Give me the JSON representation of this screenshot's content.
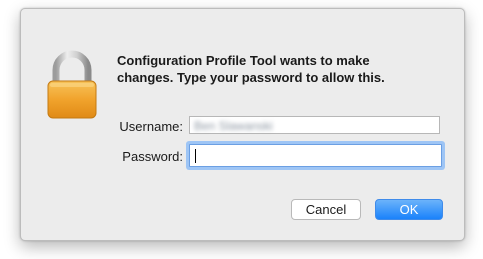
{
  "dialog": {
    "message_lines": [
      "Configuration Profile Tool wants to make",
      "changes. Type your password to allow this."
    ],
    "icon": "lock-icon",
    "username_label": "Username:",
    "username_value": "Ben Slawanski",
    "password_label": "Password:",
    "password_value": "",
    "cancel_label": "Cancel",
    "ok_label": "OK"
  },
  "colors": {
    "dialog_background": "#ececec",
    "ok_button": "#1a82fb",
    "focus_ring": "#9ec5f5",
    "lock_body": "#f0a42c",
    "lock_shackle": "#c8c8c8"
  }
}
